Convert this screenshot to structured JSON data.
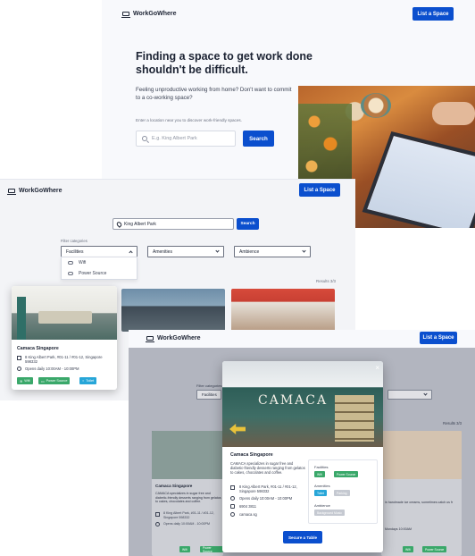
{
  "brand": "WorkGoWhere",
  "list_space_label": "List a Space",
  "landing": {
    "title": "Finding a space to get work done shouldn't be difficult.",
    "subtitle": "Feeling unproductive working from home? Don't want to commit to a co-working space?",
    "hint": "Enter a location near you to discover work-friendly spaces.",
    "search_placeholder": "E.g. King Albert Park",
    "search_button": "Search"
  },
  "results_page": {
    "search_value": "King Albert Park",
    "search_button": "Search",
    "filter_label": "Filter categories",
    "dropdowns": [
      "Facilities",
      "Amenities",
      "Ambience"
    ],
    "menu_items": [
      {
        "icon": "wifi-icon",
        "label": "Wifi"
      },
      {
        "icon": "power-source-icon",
        "label": "Power Source"
      }
    ],
    "results_count": "Results 3/3"
  },
  "card": {
    "title": "Camaca Singapore",
    "address": "8 King Albert Park, #01-11 / #01-12, Singapore 598332",
    "hours": "Opens daily   10:00AM - 10:00PM",
    "tags": [
      {
        "label": "Wifi",
        "color": "#3aa86a"
      },
      {
        "label": "Power Source",
        "color": "#3aa86a"
      },
      {
        "label": "Toilet",
        "color": "#27a6d8"
      }
    ]
  },
  "detail_page": {
    "filter_label": "Filter categories",
    "dropdown": "Facilities",
    "results_count": "Results 3/3",
    "bg_card_title": "Camaca Singapore",
    "bg_card_desc": "CAMACA specializes in sugar free and diabetic-friendly desserts ranging from gelatos to cakes, chocolates and coffee.",
    "bg_card_address": "8 King Albert Park, #01-11 / #01-12, Singapore 598332",
    "bg_card_hours": "Opens daily   10:00AM - 10:00PM",
    "bg_card_tags": [
      "Wifi",
      "Power Source"
    ],
    "bg_card2_desc": "in handmade ice creams, sometimes catch us fr",
    "bg_card2_address": "Mondays   10:00AM",
    "bg_card2_tags": [
      "Wifi",
      "Power Source"
    ]
  },
  "modal": {
    "close": "×",
    "sign_text": "CAMACA",
    "title": "Camaca Singapore",
    "description": "CAMACA specializes in sugar free and diabetic-friendly desserts ranging from gelatos to cakes, chocolates and coffee.",
    "address": "8 King Albert Park, #01-11 / #01-12, Singapore 598332",
    "hours": "Opens daily   10:00AM - 10:00PM",
    "phone": "6904 3811",
    "website": "camaca.sg",
    "facilities_label": "Facilities",
    "facilities": [
      "Wifi",
      "Power Source"
    ],
    "amenities_label": "Amenities",
    "amenities": [
      "Toilet",
      "Parking"
    ],
    "ambience_label": "Ambience",
    "ambience": [
      "Background Music"
    ],
    "cta": "Secure a Table"
  },
  "colors": {
    "primary": "#0b4fce",
    "green_tag": "#3aa86a",
    "blue_tag": "#27a6d8"
  }
}
